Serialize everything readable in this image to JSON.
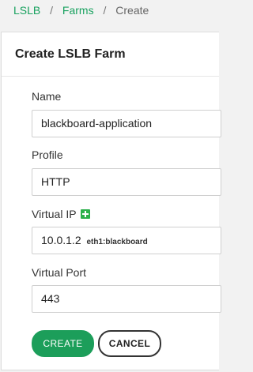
{
  "breadcrumb": {
    "items": [
      "LSLB",
      "Farms"
    ],
    "current": "Create",
    "separator": "/"
  },
  "card": {
    "title": "Create LSLB Farm"
  },
  "form": {
    "name": {
      "label": "Name",
      "value": "blackboard-application"
    },
    "profile": {
      "label": "Profile",
      "value": "HTTP"
    },
    "virtual_ip": {
      "label": "Virtual IP",
      "value": "10.0.1.2",
      "interface": "eth1:blackboard",
      "add_icon": "plus-square-icon"
    },
    "virtual_port": {
      "label": "Virtual Port",
      "value": "443"
    }
  },
  "actions": {
    "create_label": "CREATE",
    "cancel_label": "CANCEL"
  },
  "colors": {
    "accent": "#1c9e5a",
    "link": "#1aa260",
    "add_icon": "#2bb04a"
  }
}
